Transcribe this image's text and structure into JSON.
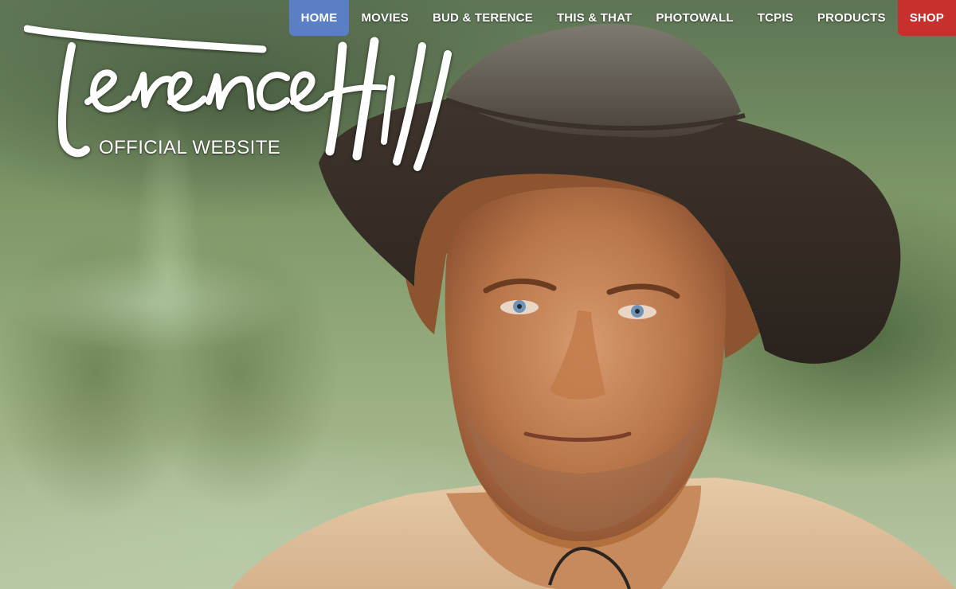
{
  "logo": {
    "name": "Terence Hill",
    "subtitle": "OFFICIAL WEBSITE"
  },
  "nav": {
    "home": "HOME",
    "movies": "MOVIES",
    "bud_terence": "BUD & TERENCE",
    "this_that": "THIS & THAT",
    "photowall": "PHOTOWALL",
    "tcpis": "TCPIS",
    "products": "PRODUCTS",
    "shop": "SHOP"
  },
  "colors": {
    "nav_active": "#5b7fc4",
    "shop_button": "#c7302c",
    "nav_text": "#ffffff"
  },
  "hero": {
    "image": "portrait-of-man-in-worn-cowboy-hat"
  }
}
